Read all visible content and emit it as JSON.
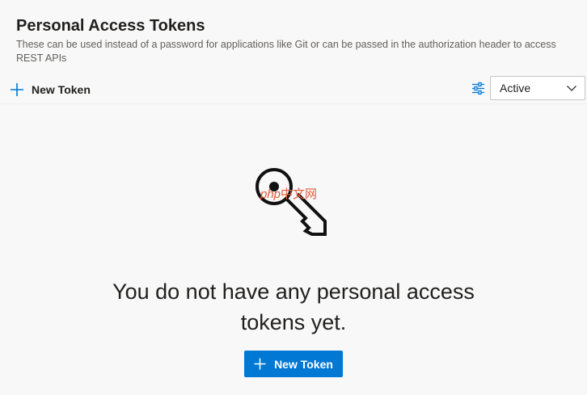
{
  "header": {
    "title": "Personal Access Tokens",
    "subtitle": "These can be used instead of a password for applications like Git or can be passed in the authorization header to access REST APIs"
  },
  "toolbar": {
    "new_token_label": "New Token",
    "new_token_icon": "plus-icon",
    "filter_icon": "filter-icon",
    "status_filter": {
      "selected": "Active",
      "icon": "chevron-down-icon"
    }
  },
  "empty_state": {
    "illustration": "key-icon",
    "watermark_php": "php",
    "watermark_cn": "中文网",
    "message": "You do not have any personal access tokens yet.",
    "button_label": "New Token",
    "button_icon": "plus-icon"
  },
  "colors": {
    "accent": "#0078d4",
    "text_primary": "#201f1e",
    "text_secondary": "#605e5c",
    "background": "#f8f8f8"
  }
}
